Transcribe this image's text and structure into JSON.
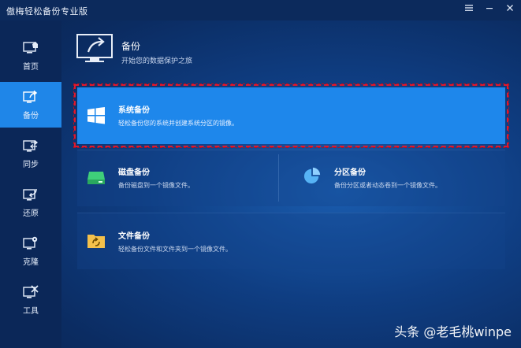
{
  "app": {
    "title": "傲梅轻松备份专业版"
  },
  "titlebar": {
    "menu_icon": "menu-icon",
    "minimize_icon": "minimize-icon",
    "close_icon": "close-icon"
  },
  "sidebar": {
    "items": [
      {
        "label": "首页",
        "icon": "home-icon",
        "active": false
      },
      {
        "label": "备份",
        "icon": "backup-icon",
        "active": true
      },
      {
        "label": "同步",
        "icon": "sync-icon",
        "active": false
      },
      {
        "label": "还原",
        "icon": "restore-icon",
        "active": false
      },
      {
        "label": "克隆",
        "icon": "clone-icon",
        "active": false
      },
      {
        "label": "工具",
        "icon": "tools-icon",
        "active": false
      }
    ]
  },
  "header": {
    "title": "备份",
    "subtitle": "开始您的数据保护之旅"
  },
  "options": {
    "system": {
      "title": "系统备份",
      "desc": "轻松备份您的系统并创建系统分区的镜像。"
    },
    "disk": {
      "title": "磁盘备份",
      "desc": "备份磁盘到一个镜像文件。"
    },
    "partition": {
      "title": "分区备份",
      "desc": "备份分区或者动态卷到一个镜像文件。"
    },
    "file": {
      "title": "文件备份",
      "desc": "轻松备份文件和文件夹到一个镜像文件。"
    }
  },
  "watermark": "头条 @老毛桃winpe",
  "colors": {
    "accent": "#1e87eb",
    "highlight_border": "#e0182d",
    "sidebar_bg": "#0b2758"
  }
}
